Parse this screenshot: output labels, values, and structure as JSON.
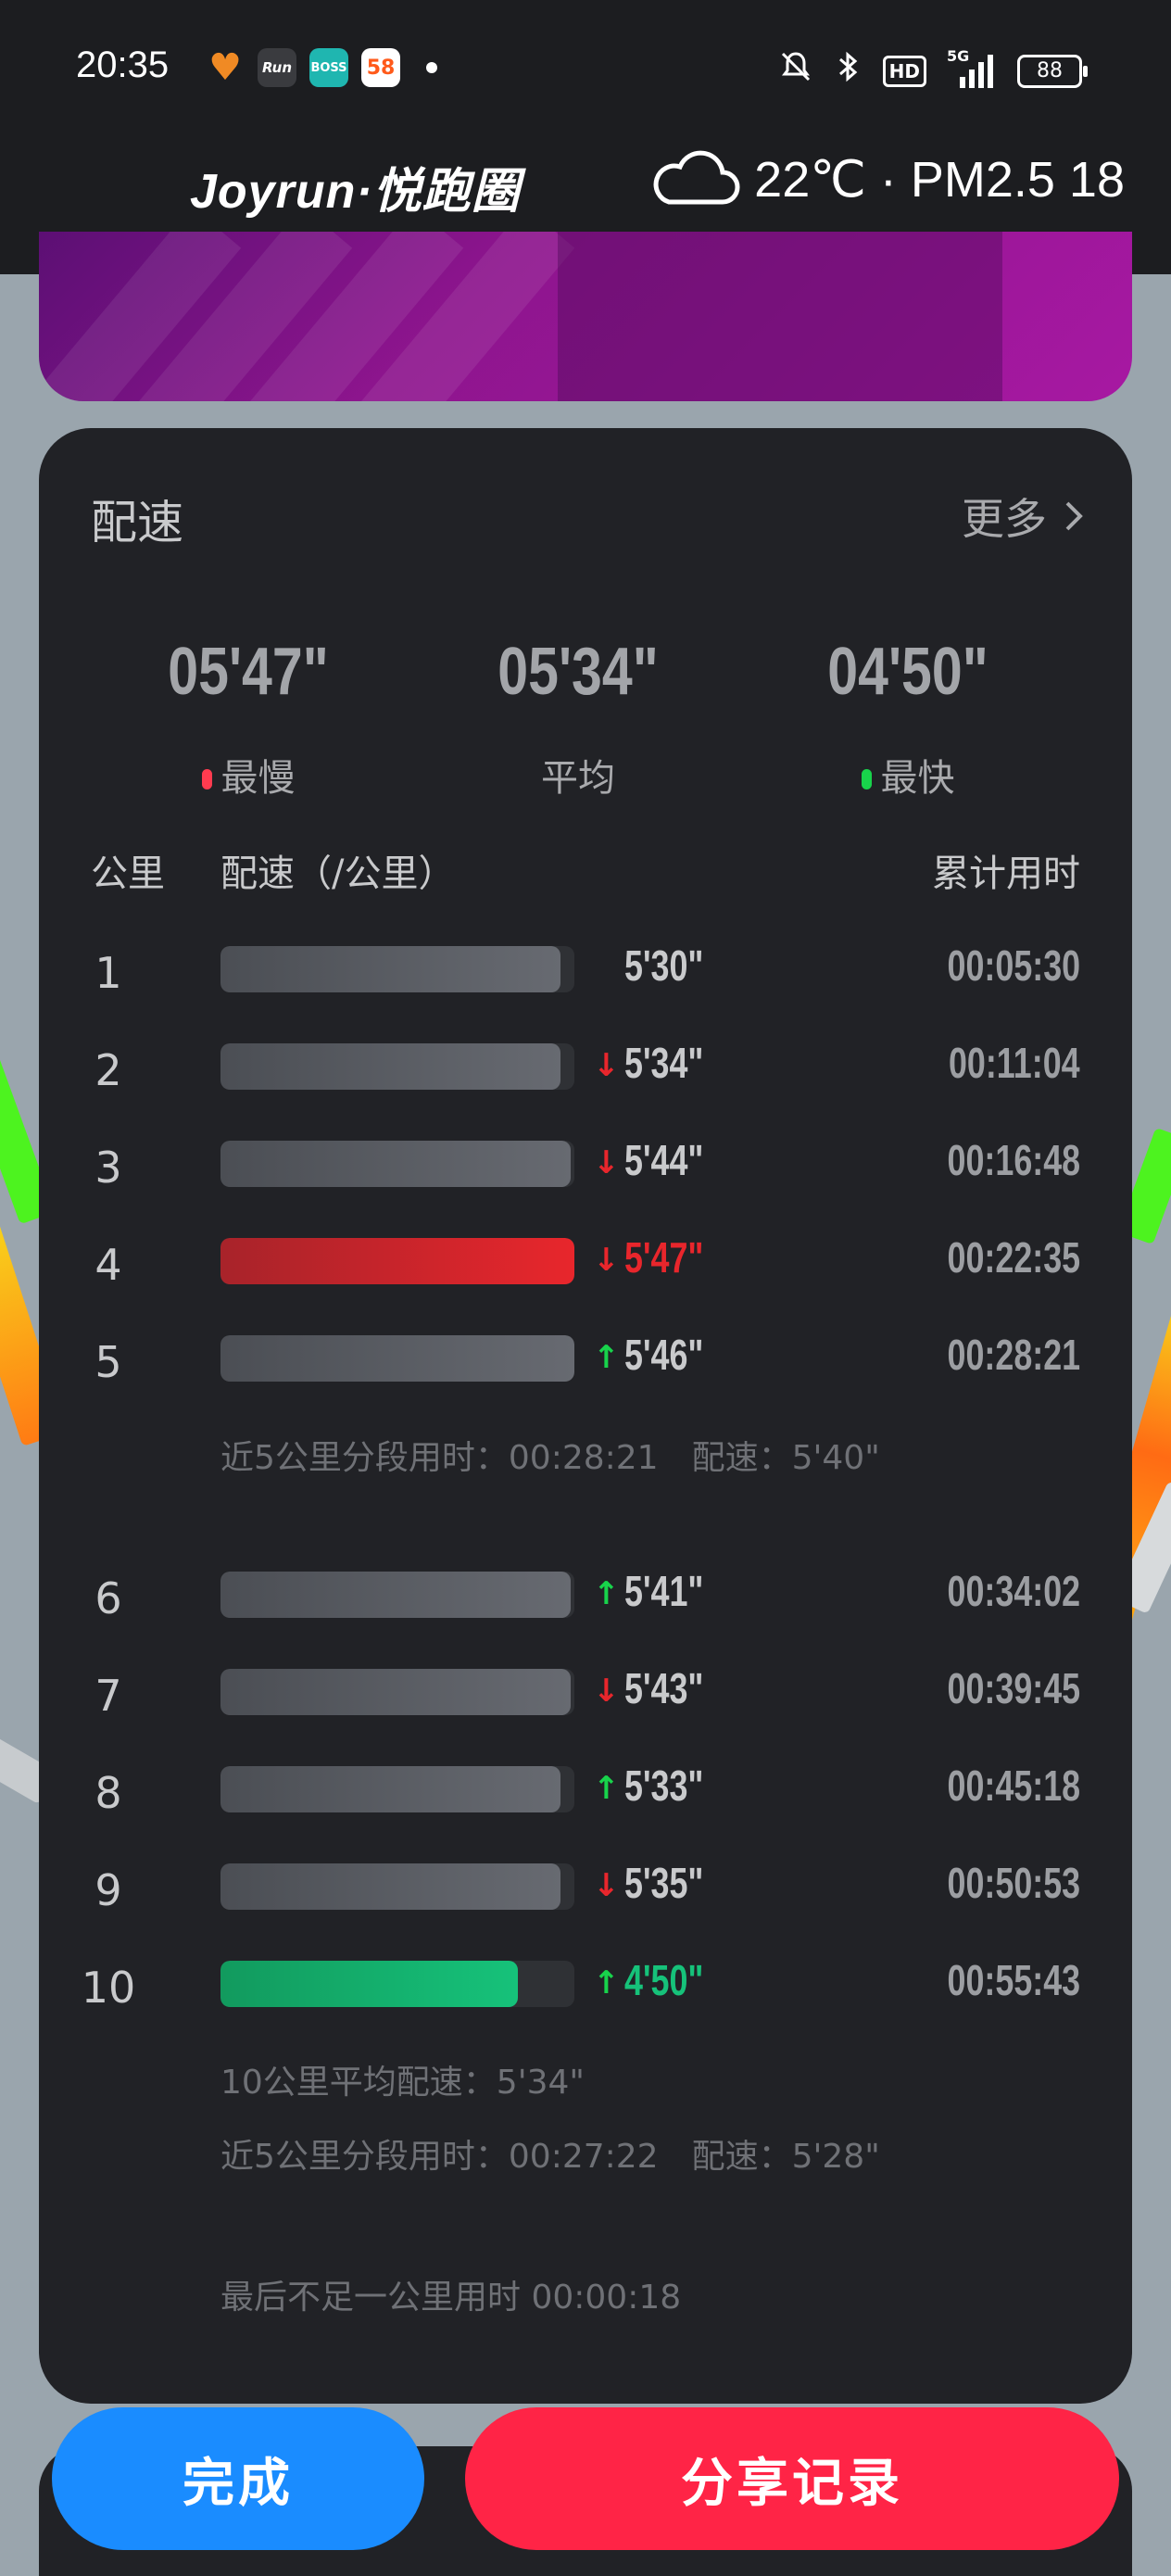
{
  "status_bar": {
    "time": "20:35",
    "apps": [
      {
        "icon": "heart-app-icon",
        "label": "",
        "color": "#f08a24"
      },
      {
        "icon": "run-app-icon",
        "label": "Run",
        "color": "#3a3b3f"
      },
      {
        "icon": "boss-app-icon",
        "label": "BOSS",
        "color": "#1fb6b0"
      },
      {
        "icon": "58-app-icon",
        "label": "58",
        "color": "#ffffff"
      }
    ],
    "network": "5G",
    "battery": "88"
  },
  "header": {
    "logo": "Joyrun·悦跑圈",
    "weather": "22℃ · PM2.5 18"
  },
  "pace_card": {
    "title": "配速",
    "more_label": "更多",
    "summary": [
      {
        "value": "05'47\"",
        "label": "最慢",
        "dot_color": "#ff3b4f"
      },
      {
        "value": "05'34\"",
        "label": "平均",
        "dot_color": ""
      },
      {
        "value": "04'50\"",
        "label": "最快",
        "dot_color": "#18d34b"
      }
    ],
    "columns": {
      "km": "公里",
      "pace": "配速（/公里）",
      "cumulative": "累计用时"
    },
    "rows": [
      {
        "km": "1",
        "pace": "5'30\"",
        "cumulative": "00:05:30",
        "trend": "",
        "level": 0.96,
        "highlight": ""
      },
      {
        "km": "2",
        "pace": "5'34\"",
        "cumulative": "00:11:04",
        "trend": "down",
        "level": 0.96,
        "highlight": ""
      },
      {
        "km": "3",
        "pace": "5'44\"",
        "cumulative": "00:16:48",
        "trend": "down",
        "level": 0.99,
        "highlight": ""
      },
      {
        "km": "4",
        "pace": "5'47\"",
        "cumulative": "00:22:35",
        "trend": "down",
        "level": 1.0,
        "highlight": "slowest"
      },
      {
        "km": "5",
        "pace": "5'46\"",
        "cumulative": "00:28:21",
        "trend": "up",
        "level": 1.0,
        "highlight": ""
      },
      {
        "km": "6",
        "pace": "5'41\"",
        "cumulative": "00:34:02",
        "trend": "up",
        "level": 0.99,
        "highlight": ""
      },
      {
        "km": "7",
        "pace": "5'43\"",
        "cumulative": "00:39:45",
        "trend": "down",
        "level": 0.99,
        "highlight": ""
      },
      {
        "km": "8",
        "pace": "5'33\"",
        "cumulative": "00:45:18",
        "trend": "up",
        "level": 0.96,
        "highlight": ""
      },
      {
        "km": "9",
        "pace": "5'35\"",
        "cumulative": "00:50:53",
        "trend": "down",
        "level": 0.96,
        "highlight": ""
      },
      {
        "km": "10",
        "pace": "4'50\"",
        "cumulative": "00:55:43",
        "trend": "up",
        "level": 0.84,
        "highlight": "fastest"
      }
    ],
    "notes": {
      "split_5": "近5公里分段用时：00:28:21　配速：5'40\"",
      "avg_10": "10公里平均配速：5'34\"",
      "split_10": "近5公里分段用时：00:27:22　配速：5'28\"",
      "remainder": "最后不足一公里用时 00:00:18"
    },
    "colors": {
      "slow": "#e8262c",
      "fast": "#16c27a",
      "up": "#18d34b",
      "down": "#e8262c"
    }
  },
  "actions": {
    "done": "完成",
    "share": "分享记录",
    "done_color": "#1a8cff",
    "share_color": "#ff2446"
  }
}
